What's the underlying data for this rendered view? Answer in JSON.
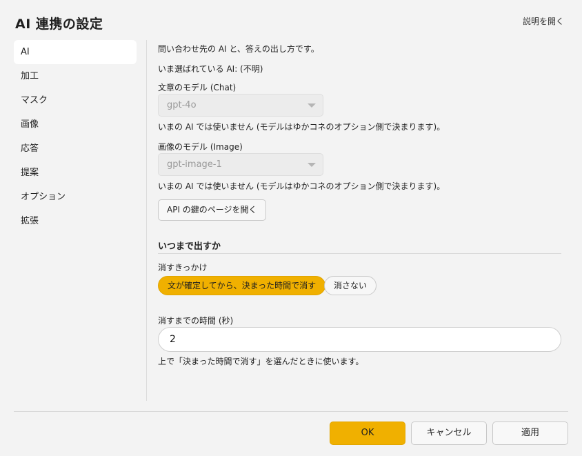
{
  "window": {
    "title": "AI 連携の設定",
    "help_link": "説明を開く"
  },
  "sidebar": {
    "items": [
      {
        "label": "AI",
        "active": true
      },
      {
        "label": "加工"
      },
      {
        "label": "マスク"
      },
      {
        "label": "画像"
      },
      {
        "label": "応答"
      },
      {
        "label": "提案"
      },
      {
        "label": "オプション"
      },
      {
        "label": "拡張"
      }
    ]
  },
  "ai": {
    "description": "問い合わせ先の AI と、答えの出し方です。",
    "current_ai": "いま選ばれている AI: (不明)",
    "chat_model_label": "文章のモデル (Chat)",
    "chat_model_value": "gpt-4o",
    "chat_model_note": "いまの AI では使いません (モデルはゆかコネのオプション側で決まります)。",
    "image_model_label": "画像のモデル (Image)",
    "image_model_value": "gpt-image-1",
    "image_model_note": "いまの AI では使いません (モデルはゆかコネのオプション側で決まります)。",
    "api_key_button": "API の鍵のページを開く"
  },
  "display": {
    "section_title": "いつまで出すか",
    "trigger_label": "消すきっかけ",
    "options": [
      {
        "label": "文が確定してから、決まった時間で消す",
        "selected": true
      },
      {
        "label": "消さない",
        "selected": false
      }
    ],
    "seconds_label": "消すまでの時間 (秒)",
    "seconds_value": "2",
    "seconds_note": "上で「決まった時間で消す」を選んだときに使います。"
  },
  "footer": {
    "ok": "OK",
    "cancel": "キャンセル",
    "apply": "適用"
  },
  "colors": {
    "accent": "#f0b000",
    "background": "#f3f3f3"
  }
}
